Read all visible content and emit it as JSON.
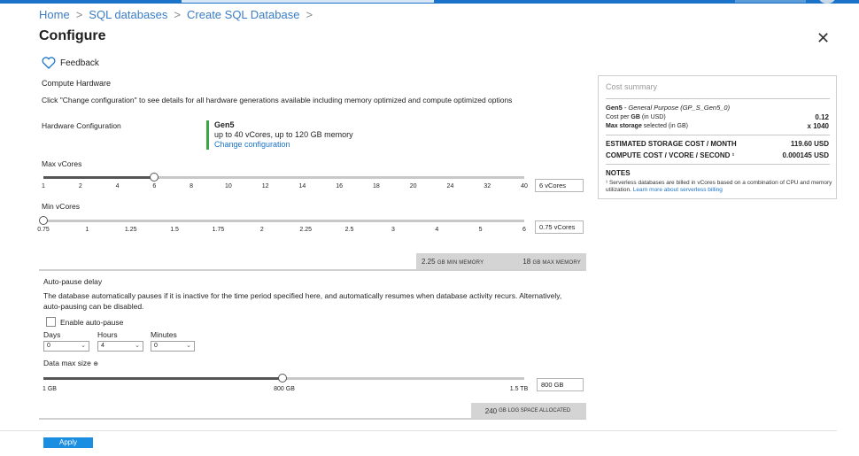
{
  "breadcrumb": [
    "Home",
    "SQL databases",
    "Create SQL Database"
  ],
  "title": "Configure",
  "feedback_label": "Feedback",
  "compute": {
    "heading": "Compute Hardware",
    "description": "Click \"Change configuration\" to see details for all hardware generations available including memory optimized and compute optimized options",
    "hw_label": "Hardware Configuration",
    "gen": "Gen5",
    "gen_detail": "up to 40 vCores, up to 120 GB memory",
    "change_link": "Change configuration"
  },
  "max_vcores": {
    "label": "Max vCores",
    "ticks": [
      "1",
      "2",
      "4",
      "6",
      "8",
      "10",
      "12",
      "14",
      "16",
      "18",
      "20",
      "24",
      "32",
      "40"
    ],
    "value": "6 vCores",
    "selected_index": 3
  },
  "min_vcores": {
    "label": "Min vCores",
    "ticks": [
      "0.75",
      "1",
      "1.25",
      "1.5",
      "1.75",
      "2",
      "2.25",
      "2.5",
      "3",
      "4",
      "5",
      "6"
    ],
    "value": "0.75 vCores",
    "selected_index": 0
  },
  "memory": {
    "min_value": "2.25",
    "min_unit": "GB MIN MEMORY",
    "max_value": "18",
    "max_unit": "GB MAX MEMORY"
  },
  "autopause": {
    "heading": "Auto-pause delay",
    "description": "The database automatically pauses if it is inactive for the time period specified here, and automatically resumes when database activity recurs. Alternatively, auto-pausing can be disabled.",
    "enable_label": "Enable auto-pause",
    "enabled": false,
    "days_label": "Days",
    "days_value": "0",
    "hours_label": "Hours",
    "hours_value": "4",
    "minutes_label": "Minutes",
    "minutes_value": "0"
  },
  "data_size": {
    "label": "Data max size",
    "info_icon": "⊕",
    "tick_min": "1 GB",
    "tick_mid": "800 GB",
    "tick_max": "1.5 TB",
    "value": "800 GB",
    "fraction": 0.5
  },
  "log_space": {
    "value": "240",
    "unit": "GB LOG SPACE ALLOCATED"
  },
  "cost_summary": {
    "heading": "Cost summary",
    "gen": "Gen5",
    "gen_detail": " - General Purpose (GP_S_Gen5_0)",
    "cost_per_gb_label_pre": "Cost per ",
    "cost_per_gb_label_bold": "GB",
    "cost_per_gb_label_post": " (in USD)",
    "cost_per_gb_value": "0.12",
    "max_storage_label_bold": "Max storage",
    "max_storage_label_post": " selected (in GB)",
    "max_storage_value": "x 1040",
    "storage_cost_label": "ESTIMATED STORAGE COST / MONTH",
    "storage_cost_value": "119.60 USD",
    "compute_cost_label": "COMPUTE COST / VCORE / SECOND ¹",
    "compute_cost_value": "0.000145 USD",
    "notes_heading": "NOTES",
    "notes_text": "¹ Serverless databases are billed in vCores based on a combination of CPU and memory utilization. ",
    "notes_link": "Learn more about serverless billing"
  },
  "apply_label": "Apply",
  "colors": {
    "accent": "#1a73c8",
    "green_bar": "#3aa842",
    "apply": "#1a8ee0"
  }
}
